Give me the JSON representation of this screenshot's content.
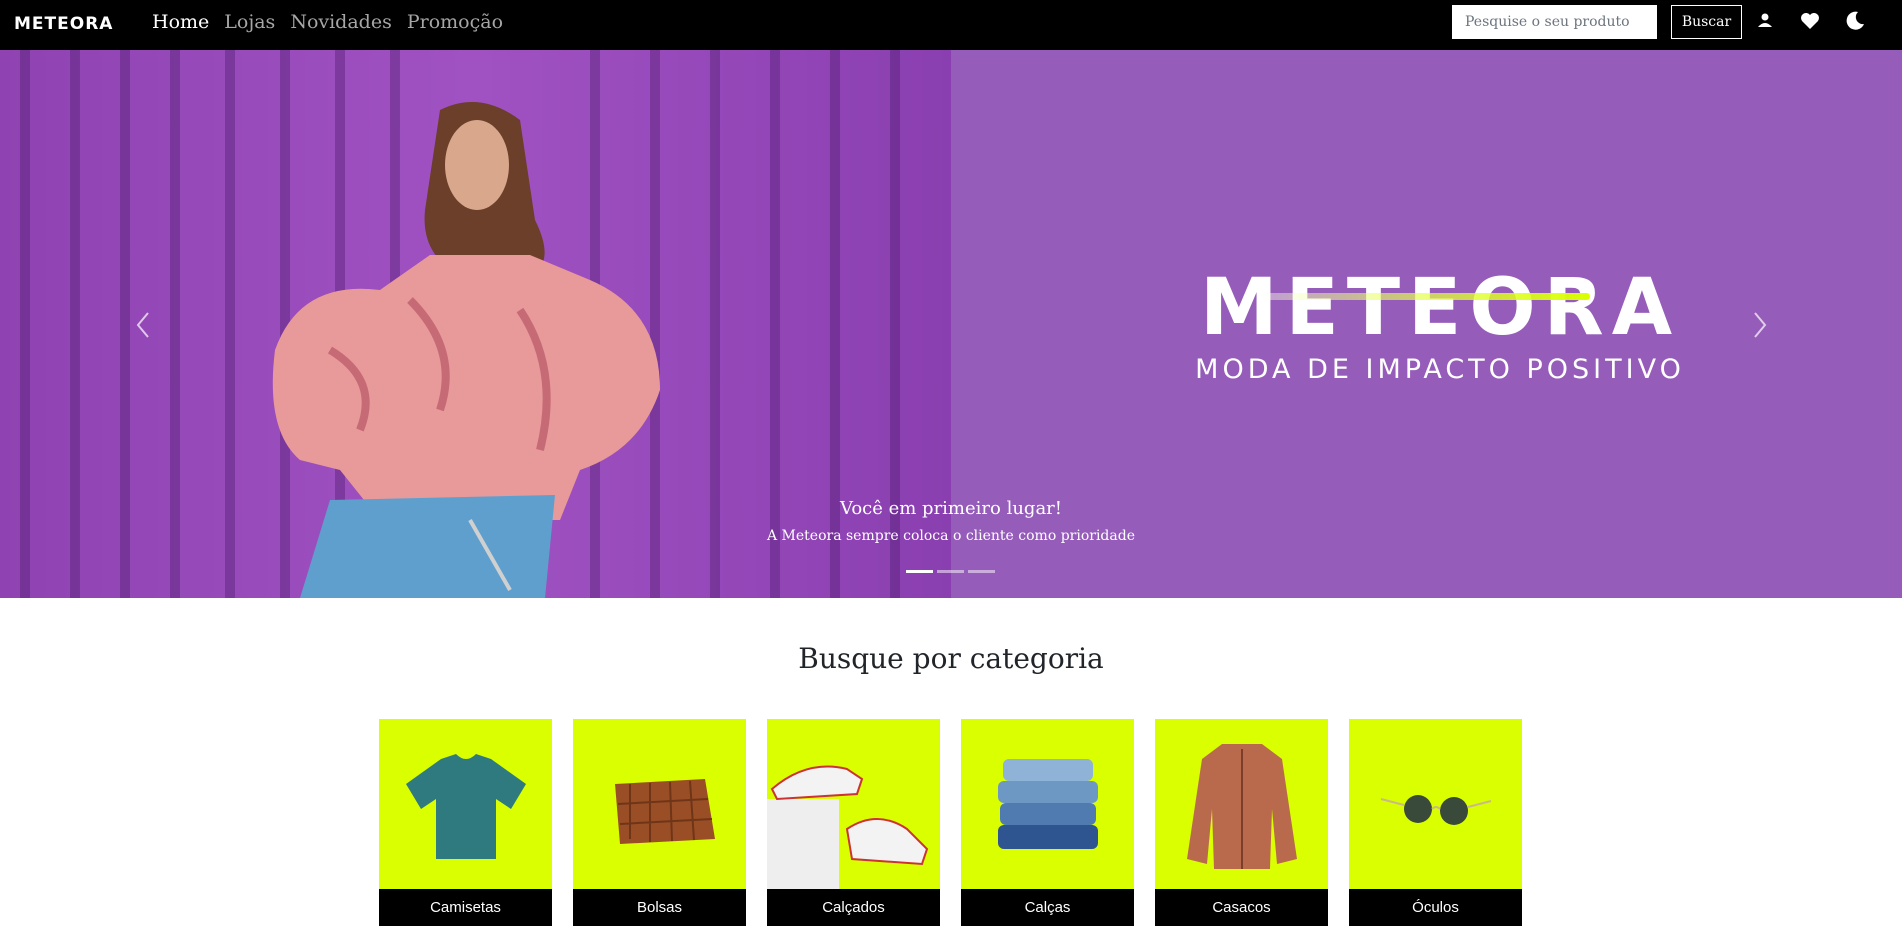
{
  "navbar": {
    "logo_text": "METEORA",
    "links": [
      {
        "label": "Home",
        "active": true
      },
      {
        "label": "Lojas",
        "active": false
      },
      {
        "label": "Novidades",
        "active": false
      },
      {
        "label": "Promoção",
        "active": false
      }
    ],
    "search_placeholder": "Pesquise o seu produto",
    "search_button": "Buscar",
    "icons": [
      "user-icon",
      "heart-icon",
      "moon-icon"
    ]
  },
  "carousel": {
    "brand_name": "METEORA",
    "brand_tagline": "MODA DE IMPACTO POSITIVO",
    "caption_title": "Você em primeiro lugar!",
    "caption_text": "A Meteora sempre coloca o cliente como prioridade",
    "slide_count": 3,
    "active_slide": 1,
    "background_color": "#965cba"
  },
  "categories": {
    "title": "Busque por categoria",
    "card_color": "#d9ff00",
    "items": [
      {
        "label": "Camisetas",
        "icon": "tshirt-image"
      },
      {
        "label": "Bolsas",
        "icon": "bag-image"
      },
      {
        "label": "Calçados",
        "icon": "sneakers-image"
      },
      {
        "label": "Calças",
        "icon": "jeans-image"
      },
      {
        "label": "Casacos",
        "icon": "jacket-image"
      },
      {
        "label": "Óculos",
        "icon": "sunglasses-image"
      }
    ]
  }
}
